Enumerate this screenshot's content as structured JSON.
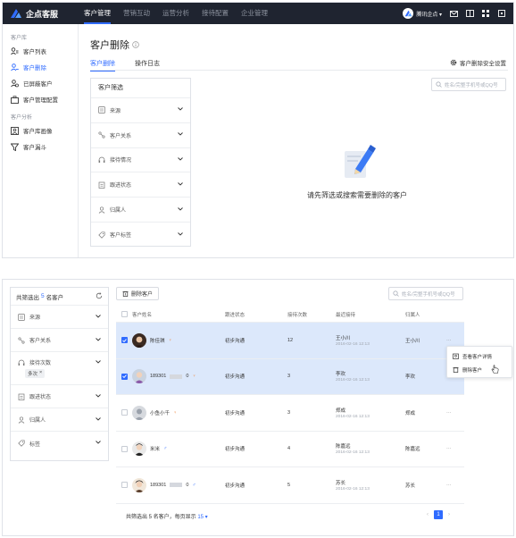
{
  "app": {
    "brand": "企点客服",
    "nav": [
      "客户管理",
      "营销互动",
      "运营分析",
      "接待配置",
      "企业管理"
    ],
    "corp": "腾讯企点 ▾"
  },
  "sidebar": {
    "group1": "客户库",
    "items1": [
      "客户列表",
      "客户删除",
      "已屏蔽客户",
      "客户管理配置"
    ],
    "group2": "客户分析",
    "items2": [
      "客户库画像",
      "客户漏斗"
    ]
  },
  "main": {
    "title": "客户删除",
    "tabs": [
      "客户删除",
      "操作日志"
    ],
    "security": "客户删除安全设置",
    "search_placeholder": "姓名/完整手机号或QQ号",
    "filter_title": "客户筛选",
    "filters": [
      "来源",
      "客户关系",
      "接待情况",
      "跟进状态",
      "归属人",
      "客户标签"
    ],
    "empty_text": "请先筛选或搜索需要删除的客户"
  },
  "panel2": {
    "filter_head_prefix": "共筛选出",
    "filter_count": "5",
    "filter_head_suffix": "名客户",
    "filters": [
      "来源",
      "客户关系",
      "接待次数",
      "跟进状态",
      "归属人",
      "标签"
    ],
    "chip": "多次",
    "delete_button": "删除客户",
    "search_placeholder": "姓名/完整手机号或QQ号",
    "columns": [
      "客户姓名",
      "跟进状态",
      "接待次数",
      "最近接待",
      "归属人"
    ],
    "rows": [
      {
        "name": "陈佳琪",
        "sex": "♀",
        "status": "初步沟通",
        "count": "12",
        "last_name": "王小川",
        "last_time": "2016-02-16 12:13",
        "owner": "王小川",
        "op": "···"
      },
      {
        "name": "189301",
        "name_suffix": "0",
        "sex": "♀",
        "status": "初步沟通",
        "count": "3",
        "last_name": "李欢",
        "last_time": "2016-02-16 12:13",
        "owner": "李欢",
        "op": ""
      },
      {
        "name": "小鱼小千",
        "sex": "♀",
        "status": "初步沟通",
        "count": "3",
        "last_name": "郑成",
        "last_time": "2016-02-16 12:13",
        "owner": "郑成",
        "op": "···"
      },
      {
        "name": "米米",
        "sex": "♂",
        "status": "初步沟通",
        "count": "4",
        "last_name": "陈嘉远",
        "last_time": "2016-02-16 12:13",
        "owner": "陈嘉远",
        "op": "···"
      },
      {
        "name": "189301",
        "name_suffix": "0",
        "sex": "♂",
        "status": "初步沟通",
        "count": "5",
        "last_name": "苏长",
        "last_time": "2016-02-16 12:13",
        "owner": "苏长",
        "op": "···"
      }
    ],
    "menu": [
      "查看客户详情",
      "删除客户"
    ],
    "footer_prefix": "共筛选出 5 名客户，每页显示",
    "footer_page_size": "15 ▾",
    "current_page": "1"
  },
  "colors": {
    "accent": "#2f6bff",
    "nav_bg": "#1f2430",
    "selected_row": "#dce8fb"
  }
}
